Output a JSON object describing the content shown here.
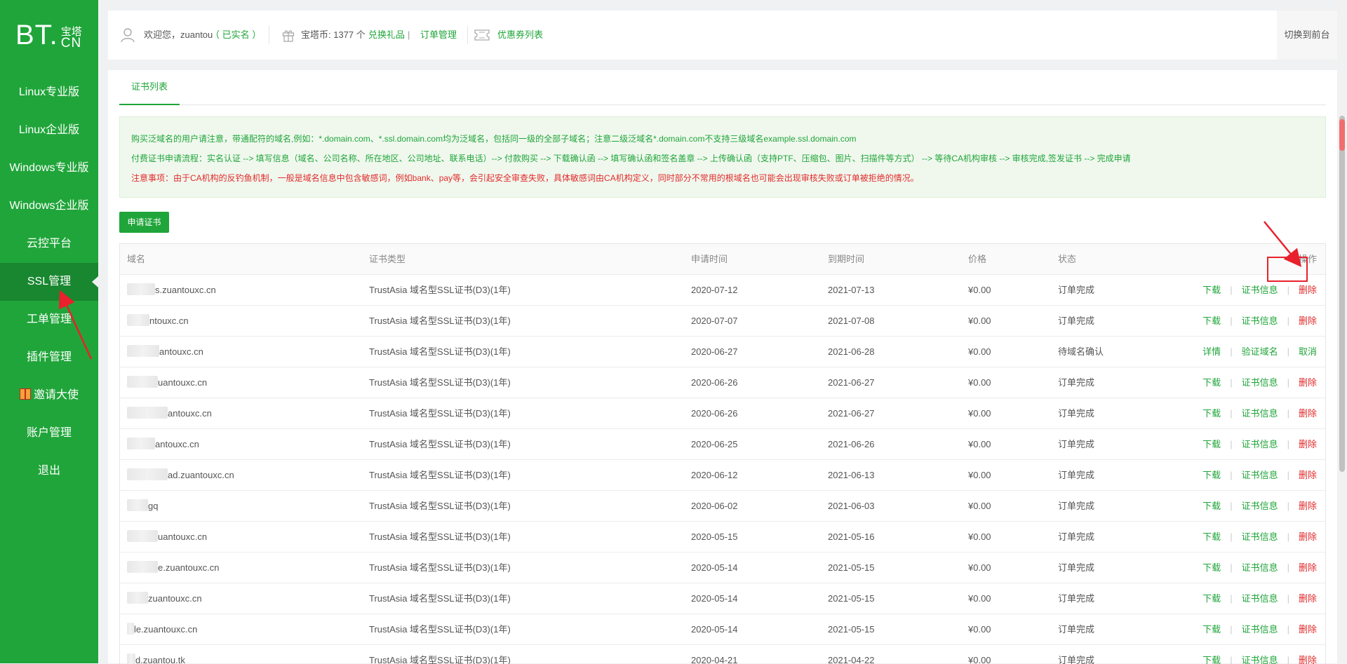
{
  "sidebar": {
    "logo": {
      "main": "BT.",
      "top": "宝塔",
      "bottom": "CN"
    },
    "items": [
      {
        "label": "Linux专业版"
      },
      {
        "label": "Linux企业版"
      },
      {
        "label": "Windows专业版"
      },
      {
        "label": "Windows企业版"
      },
      {
        "label": "云控平台"
      },
      {
        "label": "SSL管理",
        "active": true
      },
      {
        "label": "工单管理"
      },
      {
        "label": "插件管理"
      },
      {
        "label": "邀请大使",
        "icon": "gift-icon"
      },
      {
        "label": "账户管理"
      },
      {
        "label": "退出"
      }
    ]
  },
  "topbar": {
    "greeting": "欢迎您，zuantou",
    "verified": "（ 已实名 ）",
    "coins": "宝塔币: 1377 个",
    "exchange": "兑换礼品",
    "divider": "|",
    "orders": "订单管理",
    "coupons": "优惠券列表",
    "switch": "切换到前台"
  },
  "tabs": [
    {
      "label": "证书列表"
    }
  ],
  "notice": {
    "line1": "购买泛域名的用户请注意，带通配符的域名,例如：*.domain.com、*.ssl.domain.com均为泛域名，包括同一级的全部子域名；注意二级泛域名*.domain.com不支持三级域名example.ssl.domain.com",
    "line2": "付费证书申请流程：实名认证 --> 填写信息（域名、公司名称、所在地区、公司地址、联系电话）--> 付款购买 --> 下载确认函 --> 填写确认函和签名盖章 --> 上传确认函（支持PTF、压缩包、图片、扫描件等方式） --> 等待CA机构审核 --> 审核完成,签发证书 --> 完成申请",
    "line3": "注意事项：由于CA机构的反钓鱼机制，一般是域名信息中包含敏感词，例如bank、pay等，会引起安全审查失败，具体敏感词由CA机构定义，同时部分不常用的根域名也可能会出现审核失败或订单被拒绝的情况。"
  },
  "apply_button": "申请证书",
  "table": {
    "headers": {
      "domain": "域名",
      "type": "证书类型",
      "apply": "申请时间",
      "expire": "到期时间",
      "price": "价格",
      "status": "状态",
      "ops": "操作"
    },
    "rows": [
      {
        "domain": "s.zuantouxc.cn",
        "type": "TrustAsia 域名型SSL证书(D3)(1年)",
        "apply": "2020-07-12",
        "expire": "2021-07-13",
        "price": "¥0.00",
        "status": "订单完成",
        "ops": [
          "下载",
          "证书信息",
          "删除"
        ]
      },
      {
        "domain": "ntouxc.cn",
        "type": "TrustAsia 域名型SSL证书(D3)(1年)",
        "apply": "2020-07-07",
        "expire": "2021-07-08",
        "price": "¥0.00",
        "status": "订单完成",
        "ops": [
          "下载",
          "证书信息",
          "删除"
        ]
      },
      {
        "domain": "antouxc.cn",
        "type": "TrustAsia 域名型SSL证书(D3)(1年)",
        "apply": "2020-06-27",
        "expire": "2021-06-28",
        "price": "¥0.00",
        "status": "待域名确认",
        "ops": [
          "详情",
          "验证域名",
          "取消"
        ]
      },
      {
        "domain": "uantouxc.cn",
        "type": "TrustAsia 域名型SSL证书(D3)(1年)",
        "apply": "2020-06-26",
        "expire": "2021-06-27",
        "price": "¥0.00",
        "status": "订单完成",
        "ops": [
          "下载",
          "证书信息",
          "删除"
        ]
      },
      {
        "domain": "antouxc.cn",
        "type": "TrustAsia 域名型SSL证书(D3)(1年)",
        "apply": "2020-06-26",
        "expire": "2021-06-27",
        "price": "¥0.00",
        "status": "订单完成",
        "ops": [
          "下载",
          "证书信息",
          "删除"
        ]
      },
      {
        "domain": "antouxc.cn",
        "type": "TrustAsia 域名型SSL证书(D3)(1年)",
        "apply": "2020-06-25",
        "expire": "2021-06-26",
        "price": "¥0.00",
        "status": "订单完成",
        "ops": [
          "下载",
          "证书信息",
          "删除"
        ]
      },
      {
        "domain": "ad.zuantouxc.cn",
        "type": "TrustAsia 域名型SSL证书(D3)(1年)",
        "apply": "2020-06-12",
        "expire": "2021-06-13",
        "price": "¥0.00",
        "status": "订单完成",
        "ops": [
          "下载",
          "证书信息",
          "删除"
        ]
      },
      {
        "domain": "gq",
        "type": "TrustAsia 域名型SSL证书(D3)(1年)",
        "apply": "2020-06-02",
        "expire": "2021-06-03",
        "price": "¥0.00",
        "status": "订单完成",
        "ops": [
          "下载",
          "证书信息",
          "删除"
        ]
      },
      {
        "domain": "uantouxc.cn",
        "type": "TrustAsia 域名型SSL证书(D3)(1年)",
        "apply": "2020-05-15",
        "expire": "2021-05-16",
        "price": "¥0.00",
        "status": "订单完成",
        "ops": [
          "下载",
          "证书信息",
          "删除"
        ]
      },
      {
        "domain": "e.zuantouxc.cn",
        "type": "TrustAsia 域名型SSL证书(D3)(1年)",
        "apply": "2020-05-14",
        "expire": "2021-05-15",
        "price": "¥0.00",
        "status": "订单完成",
        "ops": [
          "下载",
          "证书信息",
          "删除"
        ]
      },
      {
        "domain": "zuantouxc.cn",
        "type": "TrustAsia 域名型SSL证书(D3)(1年)",
        "apply": "2020-05-14",
        "expire": "2021-05-15",
        "price": "¥0.00",
        "status": "订单完成",
        "ops": [
          "下载",
          "证书信息",
          "删除"
        ]
      },
      {
        "domain": "le.zuantouxc.cn",
        "type": "TrustAsia 域名型SSL证书(D3)(1年)",
        "apply": "2020-05-14",
        "expire": "2021-05-15",
        "price": "¥0.00",
        "status": "订单完成",
        "ops": [
          "下载",
          "证书信息",
          "删除"
        ]
      },
      {
        "domain": "d.zuantou.tk",
        "type": "TrustAsia 域名型SSL证书(D3)(1年)",
        "apply": "2020-04-21",
        "expire": "2021-04-22",
        "price": "¥0.00",
        "status": "订单完成",
        "ops": [
          "下载",
          "证书信息",
          "删除"
        ]
      }
    ]
  },
  "colors": {
    "brand": "#20a53a",
    "danger": "#e22b2b",
    "annotation": "#e8212c"
  }
}
